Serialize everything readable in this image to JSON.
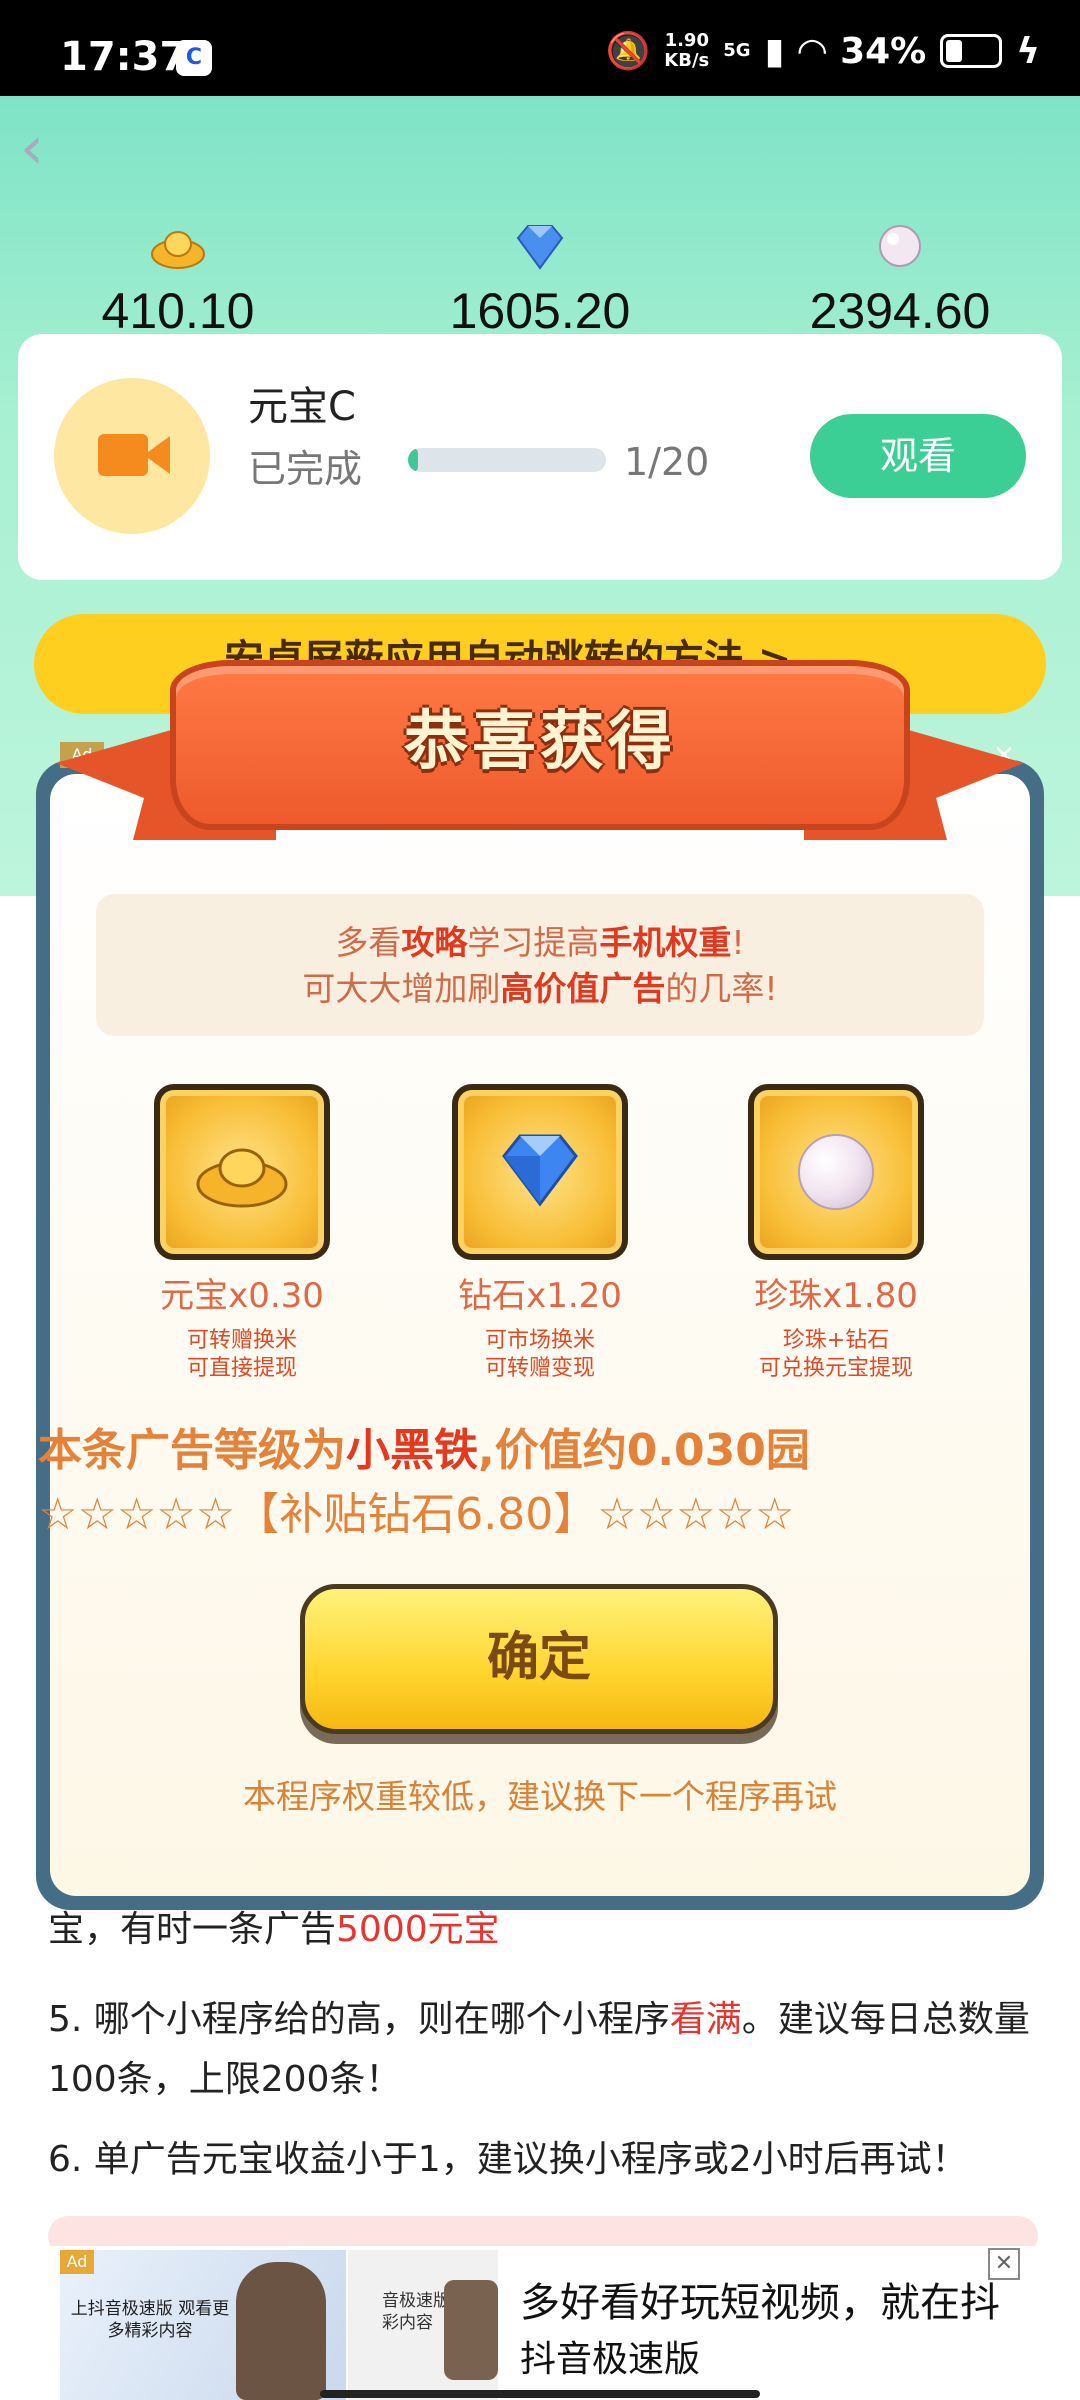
{
  "status_bar": {
    "time": "17:37",
    "net_speed_value": "1.90",
    "net_speed_unit": "KB/s",
    "network": "5G",
    "battery": "34%"
  },
  "resources": [
    {
      "icon": "gold-ingot-icon",
      "value": "410.10"
    },
    {
      "icon": "diamond-icon",
      "value": "1605.20"
    },
    {
      "icon": "pearl-icon",
      "value": "2394.60"
    }
  ],
  "task": {
    "name": "元宝C",
    "state": "已完成",
    "progress_fraction": 0.05,
    "count": "1/20",
    "watch_label": "观看"
  },
  "banner": {
    "text": "安卓屏蔽应用自动跳转的方法 >"
  },
  "article": {
    "line1_prefix": "宝，有时一条广告",
    "line1_red": "5000元宝",
    "line2_prefix": "5. 哪个小程序给的高，则在哪个小程序",
    "line2_red": "看满",
    "line2_suffix": "。建议每日总数量100条，上限200条！",
    "line3": "6. 单广告元宝收益小于1，建议换小程序或2小时后再试！"
  },
  "dialog": {
    "ad_tag": "Ad",
    "title": "恭喜获得",
    "tip_line1_a": "多看",
    "tip_line1_b": "攻略",
    "tip_line1_c": "学习提高",
    "tip_line1_d": "手机权重",
    "tip_line1_e": "!",
    "tip_line2_a": "可大大增加刷",
    "tip_line2_b": "高价值广告",
    "tip_line2_c": "的几率!",
    "rewards": [
      {
        "label": "元宝x0.30",
        "desc1": "可转赠换米",
        "desc2": "可直接提现"
      },
      {
        "label": "钻石x1.20",
        "desc1": "可市场换米",
        "desc2": "可转赠变现"
      },
      {
        "label": "珍珠x1.80",
        "desc1": "珍珠+钻石",
        "desc2": "可兑换元宝提现"
      }
    ],
    "level_prefix": "本条广告等级为",
    "level_name": "小黑铁",
    "level_suffix": ",价值约0.030园",
    "subsidy": "☆☆☆☆☆【补贴钻石6.80】☆☆☆☆☆",
    "ok_label": "确定",
    "hint": "本程序权重较低，建议换下一个程序再试"
  },
  "bottom_ad": {
    "ad_tag": "Ad",
    "thumb1_text": "上抖音极速版 观看更多精彩内容",
    "thumb2_text": "音极速版 多精彩内容",
    "headline": "多好看好玩短视频，就在抖",
    "sub": "抖音极速版",
    "close_label": "✕"
  }
}
